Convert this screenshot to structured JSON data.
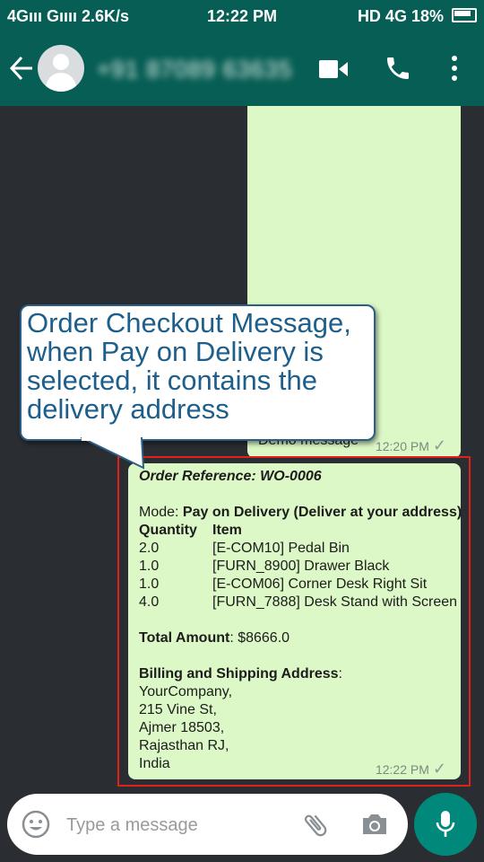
{
  "status_bar": {
    "left": "4Gııı Gıııı 2.6K/s",
    "time": "12:22 PM",
    "right": "HD 4G 18%"
  },
  "header": {
    "contact_name": "+91 87089 63635"
  },
  "messages": [
    {
      "text": "Demo message",
      "time": "12:20 PM"
    },
    {
      "order_reference": "Order Reference:  WO-0006",
      "mode_label": "Mode: ",
      "mode_value": "Pay on Delivery (Deliver at your address)",
      "col_quantity": "Quantity",
      "col_item": "Item",
      "items": [
        {
          "quantity": "2.0",
          "item": "[E-COM10] Pedal Bin"
        },
        {
          "quantity": "1.0",
          "item": "[FURN_8900] Drawer Black"
        },
        {
          "quantity": "1.0",
          "item": "[E-COM06] Corner Desk Right Sit"
        },
        {
          "quantity": "4.0",
          "item": "[FURN_7888] Desk Stand with Screen"
        }
      ],
      "total_label": "Total Amount",
      "total_value": ": $8666.0",
      "address_label": "Billing and Shipping Address",
      "address_colon": ":",
      "address_lines": [
        "YourCompany,",
        "215 Vine St,",
        "Ajmer 18503,",
        "Rajasthan RJ,",
        "India"
      ],
      "time": "12:22 PM"
    }
  ],
  "callout": {
    "text": "Order Checkout Message, when Pay on Delivery is selected, it contains the delivery address"
  },
  "input": {
    "placeholder": "Type a message"
  },
  "colors": {
    "header": "#075e54",
    "bubble": "#dcf8c6",
    "accent": "#00897b",
    "highlight": "#e0211b",
    "callout_text": "#1d5f8a"
  }
}
